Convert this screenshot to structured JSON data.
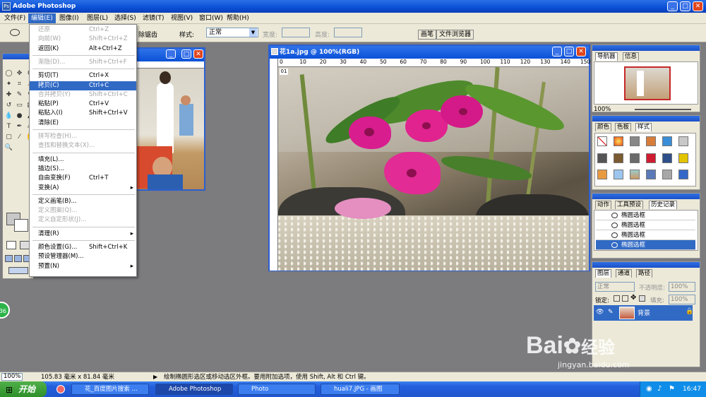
{
  "app": {
    "title": "Adobe Photoshop"
  },
  "menubar": {
    "items": [
      "文件(F)",
      "编辑(E)",
      "图像(I)",
      "图层(L)",
      "选择(S)",
      "滤镜(T)",
      "视图(V)",
      "窗口(W)",
      "帮助(H)"
    ]
  },
  "options": {
    "anti_alias_label": "除锯齿",
    "style_label": "样式:",
    "style_value": "正常",
    "width_label": "宽度:",
    "height_label": "高度:",
    "tab_brushes": "画笔",
    "tab_file_browser": "文件浏览器"
  },
  "edit_menu": {
    "items": [
      {
        "label": "还原",
        "shortcut": "Ctrl+Z",
        "disabled": true
      },
      {
        "label": "向前(W)",
        "shortcut": "Shift+Ctrl+Z",
        "disabled": true
      },
      {
        "label": "返回(K)",
        "shortcut": "Alt+Ctrl+Z",
        "disabled": false
      },
      {
        "label": "渐隐(D)...",
        "shortcut": "Shift+Ctrl+F",
        "disabled": true
      },
      {
        "label": "剪切(T)",
        "shortcut": "Ctrl+X",
        "disabled": false
      },
      {
        "label": "拷贝(C)",
        "shortcut": "Ctrl+C",
        "disabled": false,
        "highlighted": true
      },
      {
        "label": "合并拷贝(Y)",
        "shortcut": "Shift+Ctrl+C",
        "disabled": true
      },
      {
        "label": "粘贴(P)",
        "shortcut": "Ctrl+V",
        "disabled": false
      },
      {
        "label": "粘贴入(I)",
        "shortcut": "Shift+Ctrl+V",
        "disabled": false
      },
      {
        "label": "清除(E)",
        "shortcut": "",
        "disabled": false
      },
      {
        "label": "拼写检查(H)...",
        "shortcut": "",
        "disabled": true
      },
      {
        "label": "查找和替换文本(X)...",
        "shortcut": "",
        "disabled": true
      },
      {
        "label": "填充(L)...",
        "shortcut": "",
        "disabled": false
      },
      {
        "label": "描边(S)...",
        "shortcut": "",
        "disabled": false
      },
      {
        "label": "自由变换(F)",
        "shortcut": "Ctrl+T",
        "disabled": false
      },
      {
        "label": "变换(A)",
        "shortcut": "",
        "disabled": false,
        "submenu": true
      },
      {
        "label": "定义画笔(B)...",
        "shortcut": "",
        "disabled": false
      },
      {
        "label": "定义图案(Q)...",
        "shortcut": "",
        "disabled": true
      },
      {
        "label": "定义自定形状(J)...",
        "shortcut": "",
        "disabled": true
      },
      {
        "label": "清理(R)",
        "shortcut": "",
        "disabled": false,
        "submenu": true
      },
      {
        "label": "颜色设置(G)...",
        "shortcut": "Shift+Ctrl+K",
        "disabled": false
      },
      {
        "label": "预设管理器(M)...",
        "shortcut": "",
        "disabled": false
      },
      {
        "label": "预置(N)",
        "shortcut": "",
        "disabled": false,
        "submenu": true
      }
    ]
  },
  "document": {
    "title": "花1a.jpg @ 100%(RGB)",
    "ruler_ticks": [
      "0",
      "10",
      "20",
      "30",
      "40",
      "50",
      "60",
      "70",
      "80",
      "90",
      "100",
      "110",
      "120",
      "130",
      "140",
      "150"
    ],
    "layer_badge": "01"
  },
  "navigator": {
    "tabs": [
      "导航器",
      "信息"
    ],
    "zoom": "100%"
  },
  "swatches_panel": {
    "tabs": [
      "颜色",
      "色板",
      "样式"
    ]
  },
  "history_panel": {
    "tabs": [
      "动作",
      "工具预设",
      "历史记录"
    ],
    "rows": [
      "椭圆选框",
      "椭圆选框",
      "椭圆选框",
      "椭圆选框"
    ]
  },
  "layers_panel": {
    "tabs": [
      "图层",
      "通道",
      "路径"
    ],
    "blend": "正常",
    "opacity_label": "不透明度:",
    "opacity": "100%",
    "lock_label": "锁定:",
    "fill_label": "填充:",
    "fill": "100%",
    "layer_name": "背景"
  },
  "status": {
    "zoom": "100%",
    "size": "105.83 毫米 x 81.84 毫米",
    "hint": "绘制椭圆形选区或移动选区外框。要用附加选项，使用 Shift, Alt 和 Ctrl 键。"
  },
  "taskbar": {
    "start": "开始",
    "tasks": [
      "花_百度图片搜索 ...",
      "Adobe Photoshop",
      "Photo",
      "huali7.JPG - 画图"
    ],
    "time": "16:47"
  },
  "watermark": {
    "brand": "Bai",
    "brand_cn": "经验",
    "url": "jingyan.baidu.com"
  },
  "side_badge": "36",
  "colors": {
    "xp_blue": "#0a4fd6",
    "highlight": "#316ac5",
    "canvas_bg": "#7c7b7e",
    "magenta_flower": "#e0238f"
  }
}
